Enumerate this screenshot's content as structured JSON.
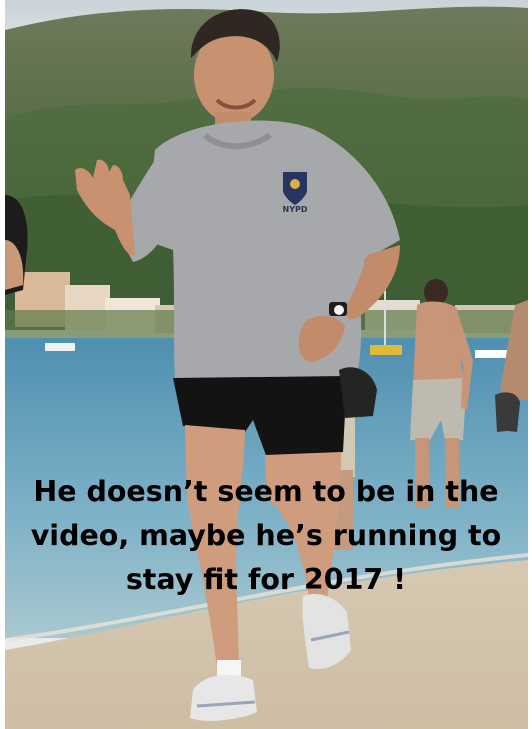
{
  "caption": {
    "line1": "He doesn’t seem to be in the",
    "line2": "video, maybe he’s running to",
    "line3": "stay fit for 2017 !"
  },
  "shirt_logo_text": "NYPD"
}
